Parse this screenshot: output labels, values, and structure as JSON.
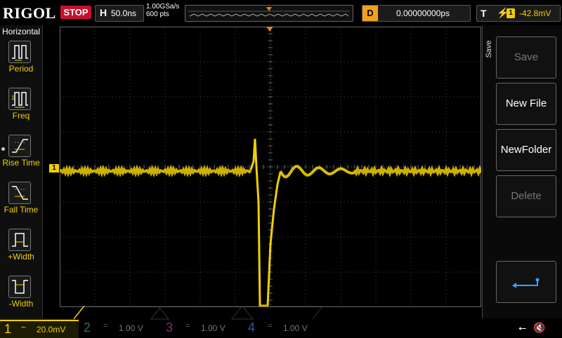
{
  "brand": "RIGOL",
  "run_state": "STOP",
  "timebase": {
    "label": "H",
    "value": "50.0ns"
  },
  "sample": {
    "rate": "1.00GSa/s",
    "points": "600 pts"
  },
  "delay": {
    "label": "D",
    "value": "0.00000000ps"
  },
  "trigger": {
    "label": "T",
    "source": "1",
    "level": "-42.8mV",
    "edge_icon": "rising-edge-icon"
  },
  "left_menu": {
    "title": "Horizontal",
    "items": [
      {
        "label": "Period",
        "icon": "period-icon"
      },
      {
        "label": "Freq",
        "icon": "freq-icon"
      },
      {
        "label": "Rise Time",
        "icon": "rise-time-icon"
      },
      {
        "label": "Fall Time",
        "icon": "fall-time-icon"
      },
      {
        "label": "+Width",
        "icon": "pos-width-icon"
      },
      {
        "label": "-Width",
        "icon": "neg-width-icon"
      }
    ]
  },
  "right_menu": {
    "tab": "Save",
    "buttons": [
      {
        "label": "Save",
        "enabled": false
      },
      {
        "label": "New File",
        "enabled": true
      },
      {
        "label": "NewFolder",
        "enabled": true
      },
      {
        "label": "Delete",
        "enabled": false
      },
      {
        "label": "",
        "icon": "return-icon",
        "enabled": true
      }
    ]
  },
  "channels": [
    {
      "num": "1",
      "coupling": "~",
      "scale": "20.0mV",
      "color": "#f0d000",
      "active": true
    },
    {
      "num": "2",
      "coupling": "=",
      "scale": "1.00 V",
      "color": "#1fb8b0",
      "active": false
    },
    {
      "num": "3",
      "coupling": "=",
      "scale": "1.00 V",
      "color": "#d040c0",
      "active": false
    },
    {
      "num": "4",
      "coupling": "=",
      "scale": "1.00 V",
      "color": "#3070e0",
      "active": false
    }
  ],
  "markers": {
    "ch1_marker": "1",
    "trigger_marker": "T"
  },
  "status_icons": [
    "usb-icon",
    "speaker-muted-icon"
  ],
  "colors": {
    "ch1": "#f0d000",
    "trigger_marker": "#f08010",
    "stop": "#c8102e"
  }
}
